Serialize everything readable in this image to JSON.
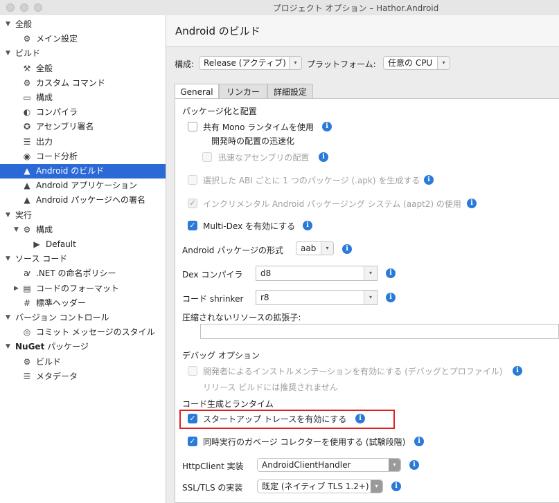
{
  "window": {
    "title": "プロジェクト オプション – Hathor.Android"
  },
  "sidebar": {
    "items": [
      {
        "label": "全般",
        "icon": "triangle-down",
        "level": 0
      },
      {
        "label": "メイン設定",
        "icon": "gear-icon",
        "level": 1
      },
      {
        "label": "ビルド",
        "icon": "triangle-down",
        "level": 0
      },
      {
        "label": "全般",
        "icon": "hammer-icon",
        "level": 1
      },
      {
        "label": "カスタム コマンド",
        "icon": "gear-icon",
        "level": 1
      },
      {
        "label": "構成",
        "icon": "window-icon",
        "level": 1
      },
      {
        "label": "コンパイラ",
        "icon": "compiler-icon",
        "level": 1
      },
      {
        "label": "アセンブリ署名",
        "icon": "badge-icon",
        "level": 1
      },
      {
        "label": "出力",
        "icon": "list-icon",
        "level": 1
      },
      {
        "label": "コード分析",
        "icon": "target-icon",
        "level": 1
      },
      {
        "label": "Android のビルド",
        "icon": "android-icon",
        "level": 1,
        "selected": true
      },
      {
        "label": "Android アプリケーション",
        "icon": "android-icon",
        "level": 1
      },
      {
        "label": "Android パッケージへの署名",
        "icon": "android-icon",
        "level": 1
      },
      {
        "label": "実行",
        "icon": "triangle-down",
        "level": 0
      },
      {
        "label": "構成",
        "icon": "gear-icon",
        "level": 1
      },
      {
        "label": "Default",
        "icon": "play-icon",
        "level": 2
      },
      {
        "label": "ソース コード",
        "icon": "triangle-down",
        "level": 0
      },
      {
        "label": ".NET の命名ポリシー",
        "icon": "ab-icon",
        "level": 1
      },
      {
        "label": "コードのフォーマット",
        "icon": "format-icon",
        "level": 1
      },
      {
        "label": "標準ヘッダー",
        "icon": "header-icon",
        "level": 1
      },
      {
        "label": "バージョン コントロール",
        "icon": "triangle-down",
        "level": 0
      },
      {
        "label": "コミット メッセージのスタイル",
        "icon": "check-circle-icon",
        "level": 1
      },
      {
        "label_bold": "NuGet",
        "label": " パッケージ",
        "icon": "triangle-down",
        "level": 0
      },
      {
        "label": "ビルド",
        "icon": "gear-icon",
        "level": 1
      },
      {
        "label": "メタデータ",
        "icon": "list-icon",
        "level": 1
      }
    ]
  },
  "header": {
    "title": "Android のビルド"
  },
  "config": {
    "config_label": "構成:",
    "config_value": "Release (アクティブ)",
    "platform_label": "プラットフォーム:",
    "platform_value": "任意の CPU"
  },
  "tabs": [
    "General",
    "リンカー",
    "詳細設定"
  ],
  "general": {
    "packaging_heading": "パッケージ化と配置",
    "shared_mono": "共有 Mono ランタイムを使用",
    "fast_deploy_heading": "開発時の配置の迅速化",
    "fast_assembly": "迅速なアセンブリの配置",
    "per_abi": "選択した ABI ごとに 1 つのパッケージ (.apk) を生成する",
    "aapt2": "インクリメンタル Android パッケージング システム (aapt2) の使用",
    "multidex": "Multi-Dex を有効にする",
    "package_format_label": "Android パッケージの形式",
    "package_format_value": "aab",
    "dex_compiler_label": "Dex コンパイラ",
    "dex_compiler_value": "d8",
    "code_shrinker_label": "コード shrinker",
    "code_shrinker_value": "r8",
    "uncompressed_label": "圧縮されないリソースの拡張子:",
    "uncompressed_value": "",
    "debug_heading": "デバッグ オプション",
    "dev_instrumentation": "開発者によるインストルメンテーションを有効にする (デバッグとプロファイル)",
    "dev_instrumentation_note": "リリース ビルドには推奨されません",
    "codegen_heading": "コード生成とランタイム",
    "startup_tracing": "スタートアップ トレースを有効にする",
    "concurrent_gc": "同時実行のガベージ コレクターを使用する (試験段階)",
    "httpclient_label": "HttpClient 実装",
    "httpclient_value": "AndroidClientHandler",
    "ssl_label": "SSL/TLS の実装",
    "ssl_value": "既定 (ネイティブ TLS 1.2+)"
  },
  "checkbox_states": {
    "shared_mono": false,
    "fast_assembly": false,
    "per_abi": false,
    "aapt2": true,
    "multidex": true,
    "dev_instrumentation": false,
    "startup_tracing": true,
    "concurrent_gc": true
  },
  "colors": {
    "accent": "#2a7ad8",
    "selection": "#2a69d6",
    "highlight": "#e02020"
  }
}
